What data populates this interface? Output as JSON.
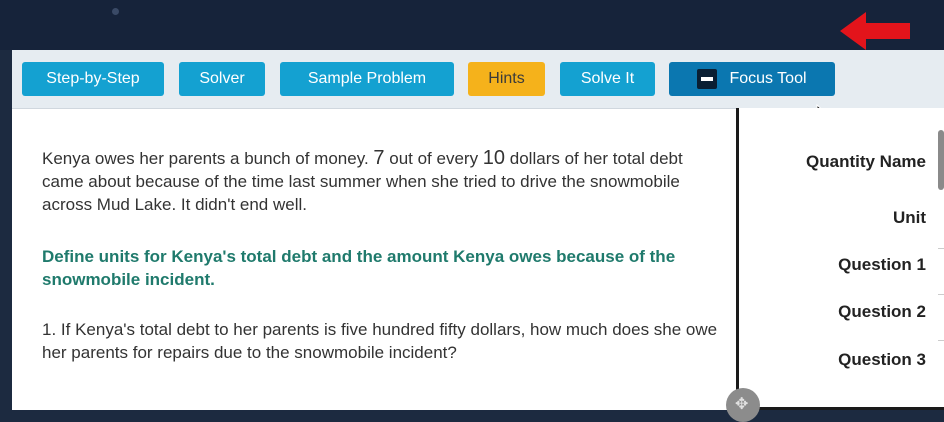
{
  "toolbar": {
    "buttons": [
      {
        "label": "Step-by-Step"
      },
      {
        "label": "Solver"
      },
      {
        "label": "Sample Problem"
      },
      {
        "label": "Hints"
      },
      {
        "label": "Solve It"
      },
      {
        "label": "Focus Tool"
      }
    ]
  },
  "problem": {
    "intro_part1": "Kenya owes her parents a bunch of money. ",
    "intro_num1": "7",
    "intro_part2": " out of every ",
    "intro_num2": "10",
    "intro_part3": " dollars of her total debt came about because of the time last summer when she tried to drive the snowmobile across Mud Lake. It didn't end well.",
    "define": "Define units for Kenya's total debt and the amount Kenya owes because of the snowmobile incident.",
    "question1": "1.  If Kenya's total debt to her parents is five hundred fifty dollars, how much does she owe her parents for repairs due to the snowmobile incident?"
  },
  "table": {
    "rows": [
      "Quantity Name",
      "Unit",
      "Question 1",
      "Question 2",
      "Question 3"
    ]
  },
  "colors": {
    "primary_button": "#14a1d1",
    "hints_button": "#f5b21b",
    "focus_button": "#0b77b0",
    "define_text": "#1f7a6c",
    "arrow": "#e3141b"
  },
  "icons": {
    "focus": "minus-square-icon",
    "annotation": "red-arrow-icon",
    "pointer": "mouse-cursor-icon",
    "move": "move-icon"
  }
}
